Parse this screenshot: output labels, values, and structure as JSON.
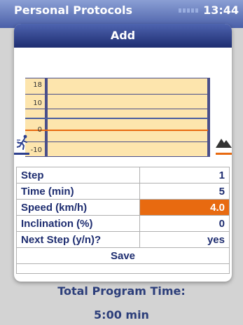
{
  "background": {
    "title": "Personal Protocols",
    "clock": "13:44"
  },
  "dialog": {
    "title": "Add",
    "chart": {
      "y_ticks": [
        "18",
        "10",
        "0",
        "-10"
      ],
      "left_icon": "runner-icon",
      "right_icon": "mountain-icon"
    },
    "rows": [
      {
        "label": "Step",
        "value": "1"
      },
      {
        "label": "Time (min)",
        "value": "5"
      },
      {
        "label": "Speed (km/h)",
        "value": "4.0"
      },
      {
        "label": "Inclination (%)",
        "value": "0"
      },
      {
        "label": "Next Step (y/n)?",
        "value": "yes"
      }
    ],
    "save_label": "Save"
  },
  "footer": {
    "total_label": "Total Program Time:",
    "total_value": "5:00 min"
  },
  "colors": {
    "accent": "#e86a10",
    "header": "#1e2d70",
    "chart_fill": "#fde5ad"
  }
}
